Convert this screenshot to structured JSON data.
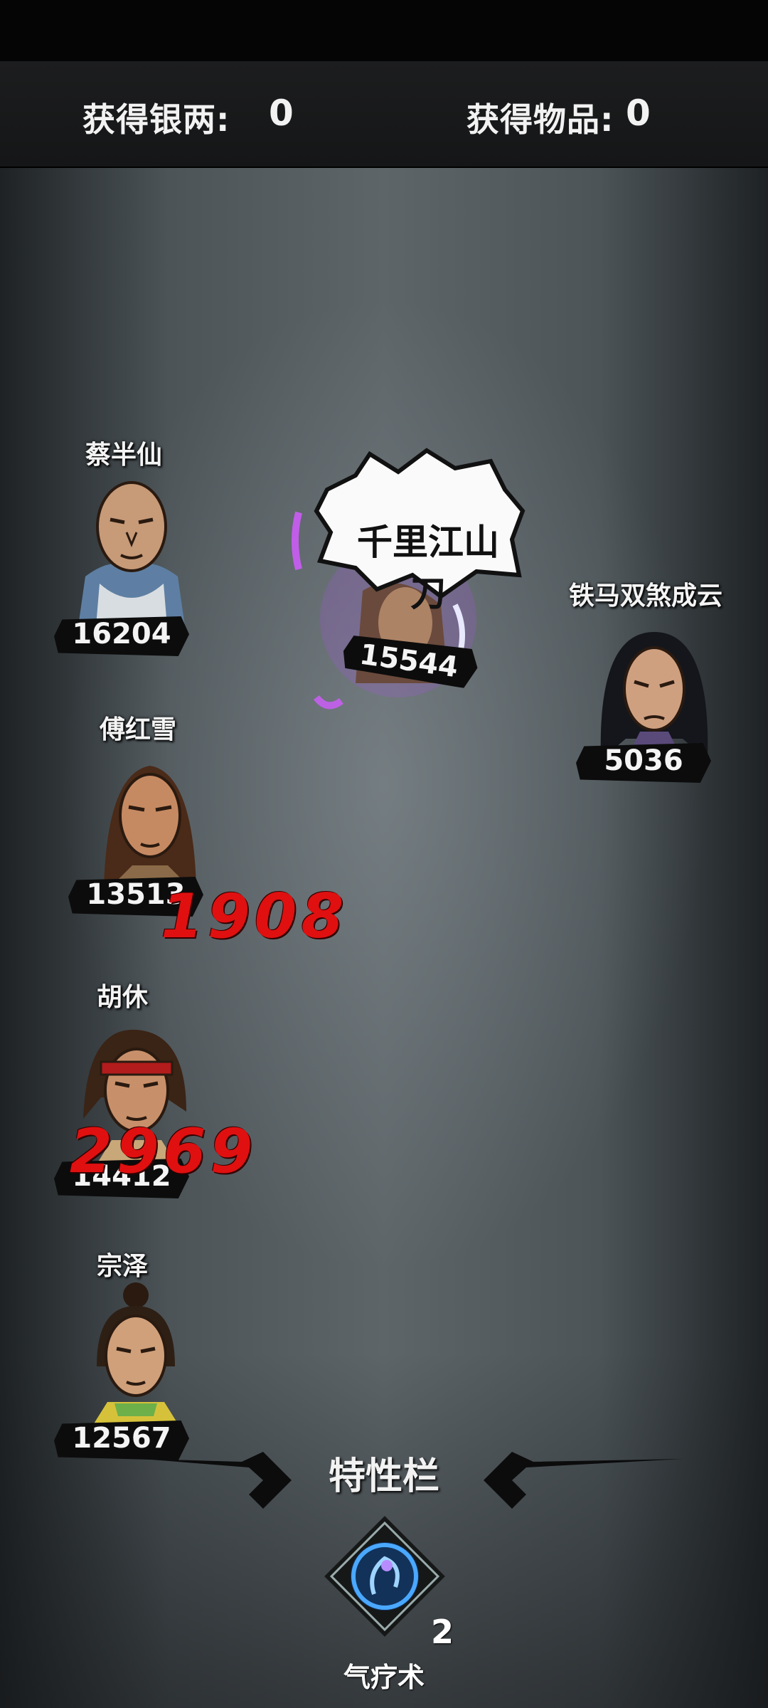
{
  "header": {
    "silver_label": "获得银两:",
    "silver_value": "0",
    "items_label": "获得物品:",
    "items_value": "0"
  },
  "allies": [
    {
      "name": "蔡半仙",
      "hp": "16204"
    },
    {
      "name": "傅红雪",
      "hp": "13513"
    },
    {
      "name": "胡休",
      "hp": "14412"
    },
    {
      "name": "宗泽",
      "hp": "12567"
    }
  ],
  "enemies": [
    {
      "name": "",
      "hp": "15544"
    },
    {
      "name": "铁马双煞成云",
      "hp": "5036"
    }
  ],
  "skill_callout": "千里江山刀",
  "damage_numbers": [
    "1908",
    "2969"
  ],
  "trait_bar": {
    "title": "特性栏",
    "skill_name": "气疗术",
    "skill_count": "2"
  },
  "colors": {
    "damage": "#e01010",
    "purple_effect": "#c44dff",
    "skill_glow": "#4aa8ff"
  }
}
